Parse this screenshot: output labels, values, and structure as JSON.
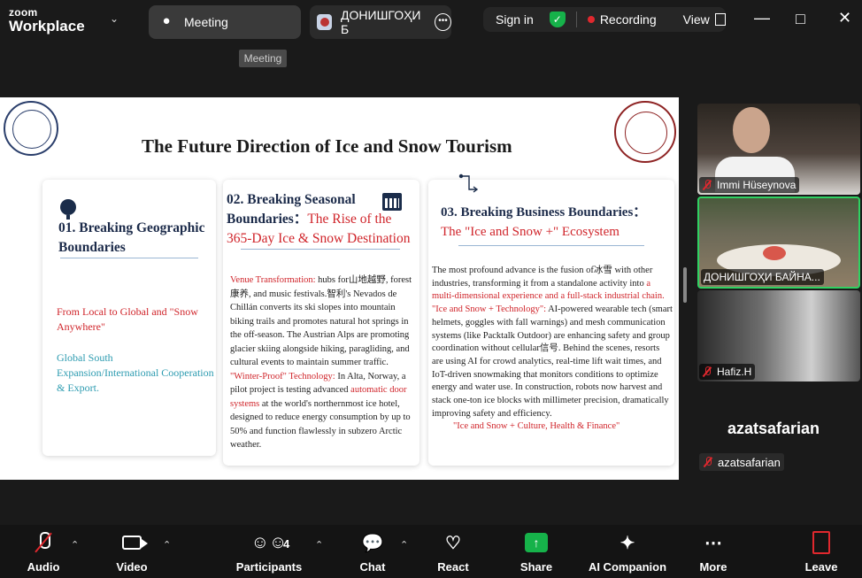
{
  "app": {
    "brand_top": "zoom",
    "brand_bottom": "Workplace"
  },
  "tabs": [
    {
      "label": "Meeting"
    },
    {
      "label": "ДОНИШГОҲИ Б"
    }
  ],
  "status": {
    "signin": "Sign in",
    "recording": "Recording",
    "view": "View"
  },
  "tooltip": "Meeting",
  "slide": {
    "title": "The Future Direction of Ice and Snow Tourism",
    "card1": {
      "heading": "01. Breaking Geographic Boundaries",
      "red_text": "From Local to Global and \"Snow Anywhere\"",
      "teal_text": "Global South Expansion/International Cooperation & Export."
    },
    "card2": {
      "heading_a": "02. Breaking Seasonal Boundaries：",
      "heading_b": "The Rise of the 365-Day Ice & Snow Destination",
      "p1_label": "Venue Transformation:",
      "p1_text": " hubs for山地越野, forest康养, and music festivals.智利's Nevados de Chillán converts its ski slopes into mountain biking trails and promotes natural hot springs in the off-season. The Austrian Alps are promoting glacier skiing alongside hiking, paragliding, and cultural events to maintain summer traffic.",
      "p2_label": "\"Winter-Proof\" Technology:",
      "p2_text_a": " In Alta, Norway, a pilot project is testing advanced ",
      "p2_red": "automatic door systems",
      "p2_text_b": " at the world's northernmost ice hotel, designed to reduce energy consumption by up to 50% and function flawlessly in subzero Arctic weather."
    },
    "card3": {
      "heading_a": "03. Breaking Business Boundaries：",
      "heading_b": "The \"Ice and Snow +\" Ecosystem",
      "p1_text": "The most profound advance is the fusion of冰雪 with other industries, transforming it from a standalone activity into ",
      "p1_red": "a multi-dimensional experience and a full-stack industrial chain.",
      "p2_label": "\"Ice and Snow + Technology\":",
      "p2_text": "  AI-powered wearable tech (smart helmets, goggles with fall warnings) and mesh communication systems (like Packtalk Outdoor) are enhancing safety and group coordination without cellular信号. Behind the scenes, resorts are using AI for crowd analytics, real-time lift wait times, and IoT-driven snowmaking that monitors conditions to optimize energy and water use. In construction, robots now harvest and stack one-ton ice blocks with millimeter precision, dramatically improving safety and efficiency.",
      "footer": "\"Ice and Snow + Culture, Health & Finance\""
    }
  },
  "participants_tiles": [
    {
      "name": "Immi Hüseynova"
    },
    {
      "name": "ДОНИШГОҲИ БАЙНА..."
    },
    {
      "name": "Hafiz.H"
    }
  ],
  "self_view": {
    "big_name": "azatsafarian",
    "tag_name": "azatsafarian"
  },
  "toolbar": {
    "audio": "Audio",
    "video": "Video",
    "participants": "Participants",
    "participants_count": "4",
    "chat": "Chat",
    "react": "React",
    "share": "Share",
    "ai": "AI Companion",
    "more": "More",
    "leave": "Leave"
  },
  "colors": {
    "accent_green": "#16b24a",
    "record_red": "#e0282e",
    "slide_red": "#d0252b",
    "slide_teal": "#2c9bb0",
    "slide_navy": "#1c2b4a"
  }
}
